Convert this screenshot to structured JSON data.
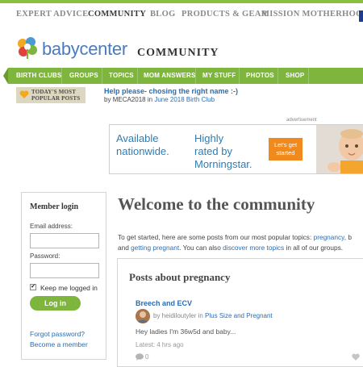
{
  "top_nav": {
    "items": [
      "EXPERT ADVICE",
      "COMMUNITY",
      "BLOG",
      "PRODUCTS & GEAR",
      "MISSION MOTHERHOOD"
    ],
    "active": "COMMUNITY"
  },
  "brand": {
    "name": "babycenter",
    "section": "COMMUNITY"
  },
  "green_nav": {
    "items": [
      "BIRTH CLUBS",
      "GROUPS",
      "TOPICS",
      "MOM ANSWERS",
      "MY STUFF",
      "PHOTOS",
      "SHOP"
    ]
  },
  "popular": {
    "label_line1": "TODAY'S MOST",
    "label_line2": "POPULAR POSTS",
    "post_title": "Help please- chosing the right name :-)",
    "by": "by",
    "author": "MECA2018",
    "in": "in",
    "club": "June 2018 Birth Club"
  },
  "ad": {
    "label": "advertisement",
    "text1_line1": "Available",
    "text1_line2": "nationwide.",
    "text2_line1": "Highly",
    "text2_line2": "rated by",
    "text2_line3": "Morningstar.",
    "cta_line1": "Let's get",
    "cta_line2": "started"
  },
  "login": {
    "title": "Member login",
    "email_label": "Email address:",
    "email_value": "",
    "password_label": "Password:",
    "password_value": "",
    "remember_label": "Keep me logged in",
    "remember_checked": "✔",
    "button": "Log in",
    "forgot": "Forgot password?",
    "become": "Become a member"
  },
  "main": {
    "welcome": "Welcome to the community",
    "intro_1": "To get started, here are some posts from our most popular topics: ",
    "intro_link1": "pregnancy",
    "intro_2": ", b",
    "intro_3": "and ",
    "intro_link2": "getting pregnant",
    "intro_4": ". You can also ",
    "intro_link3": "discover more topics",
    "intro_5": " in all of our groups."
  },
  "posts": {
    "heading": "Posts about pregnancy",
    "item": {
      "title": "Breech and ECV",
      "by": "by heidiloutyler in ",
      "group": "Plus Size and Pregnant",
      "excerpt": "Hey ladies I'm 36w5d and baby...",
      "time": "Latest: 4 hrs ago",
      "comments": "0"
    }
  },
  "colors": {
    "brand_green": "#7eb53c",
    "link_blue": "#2a6db5",
    "cta_orange": "#f08a1c"
  },
  "icons": [
    "heart-icon",
    "comment-icon",
    "like-icon",
    "babycenter-logo-icon"
  ]
}
